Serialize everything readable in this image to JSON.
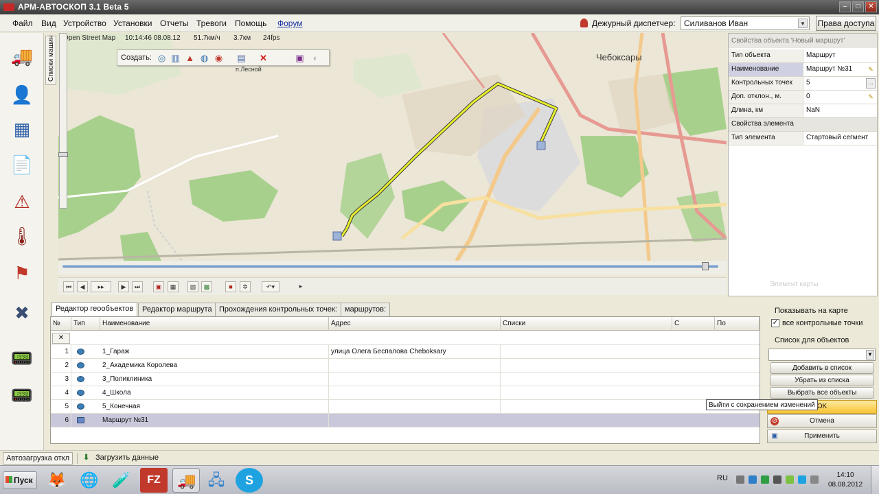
{
  "window": {
    "title": "АРМ-АВТОСКОП 3.1 Beta 5",
    "controls": {
      "minimize": "–",
      "maximize": "□",
      "close": "✕"
    }
  },
  "menu": {
    "items": [
      "Файл",
      "Вид",
      "Устройство",
      "Установки",
      "Отчеты",
      "Тревоги",
      "Помощь"
    ],
    "link": "Форум",
    "dispatcher_label": "Дежурный диспетчер:",
    "dispatcher_value": "Силиванов Иван",
    "rights_button": "Права доступа"
  },
  "left_toolbar": {
    "vertical_tab": "Списки машин",
    "buttons": [
      {
        "name": "vehicle-card-icon",
        "glyph": "🚚",
        "color": "#5d6e86"
      },
      {
        "name": "driver-icon",
        "glyph": "👤",
        "color": "#2d5d8c"
      },
      {
        "name": "calendar-grid-icon",
        "glyph": "▦",
        "color": "#2f5fa8"
      },
      {
        "name": "document-alert-icon",
        "glyph": "📄",
        "color": "#5f6d7c"
      },
      {
        "name": "alarm-device-icon",
        "glyph": "⚠",
        "color": "#b12a1f"
      },
      {
        "name": "temperature-icon",
        "glyph": "🌡",
        "color": "#8a1f17"
      },
      {
        "name": "route-flags-icon",
        "glyph": "⚑",
        "color": "#c0392b"
      },
      {
        "name": "tools-icon",
        "glyph": "✖",
        "color": "#3b4f73"
      },
      {
        "name": "tracker-device-icon",
        "glyph": "📟",
        "color": "#b12a1f"
      },
      {
        "name": "tracker-device-2-icon",
        "glyph": "📟",
        "color": "#b12a1f"
      }
    ]
  },
  "map": {
    "provider": "Open Street Map",
    "time": "10:14:46 08.08.12",
    "speed": "51.7км/ч",
    "distance": "3.7км",
    "fps": "24fps",
    "city_label": "Чебоксары",
    "village_label": "п.Лесной",
    "create_label": "Создать:",
    "route_color": "#e8ef2a",
    "timeline_position": 0.98
  },
  "properties": {
    "header": "Свойства объекта 'Новый маршрут'",
    "rows": [
      {
        "key": "Тип объекта",
        "value": "Маршрут"
      },
      {
        "key": "Наименование",
        "value": "Маршрут №31"
      },
      {
        "key": "Контрольных точек",
        "value": "5"
      },
      {
        "key": "Доп. отклон., м.",
        "value": "0"
      },
      {
        "key": "Длина, км",
        "value": "NaN"
      },
      {
        "key": "Свойства элемента",
        "value": ""
      },
      {
        "key": "Тип элемента",
        "value": "Стартовый сегмент"
      }
    ],
    "footer": "Элемент карты"
  },
  "editor": {
    "tabs": [
      "Редактор геообъектов",
      "Редактор маршрута",
      "Прохождения контрольных точек:",
      "маршрутов:"
    ],
    "columns": [
      "№",
      "Тип",
      "Наименование",
      "Адрес",
      "Списки",
      "С",
      "По"
    ],
    "filter_clear": "✕",
    "rows": [
      {
        "num": "1",
        "name": "1_Гараж",
        "address": "улица Олега Беспалова Cheboksary"
      },
      {
        "num": "2",
        "name": "2_Академика Королева",
        "address": ""
      },
      {
        "num": "3",
        "name": "3_Поликлиника",
        "address": ""
      },
      {
        "num": "4",
        "name": "4_Школа",
        "address": ""
      },
      {
        "num": "5",
        "name": "5_Конечная",
        "address": ""
      },
      {
        "num": "6",
        "name": "Маршрут №31",
        "address": ""
      }
    ]
  },
  "side_controls": {
    "show_on_map": "Показывать на карте",
    "all_checkpoints": "все контрольные точки",
    "list_label": "Список для объектов",
    "add_to_list": "Добавить в список",
    "remove_from_list": "Убрать из списка",
    "select_all": "Выбрать все объекты",
    "ok": "OK",
    "cancel": "Отмена",
    "apply": "Применить",
    "tooltip": "Выйти с сохранением изменений"
  },
  "statusbar": {
    "autoload": "Автозагрузка откл",
    "load_data": "Загрузить данные"
  },
  "taskbar": {
    "start": "Пуск",
    "language": "RU",
    "time": "14:10",
    "date": "08.08.2012",
    "apps": [
      {
        "name": "firefox-icon",
        "glyph": "🦊"
      },
      {
        "name": "mail-client-icon",
        "glyph": "🌐"
      },
      {
        "name": "media-app-icon",
        "glyph": "🧪"
      },
      {
        "name": "filezilla-icon",
        "glyph": "FZ"
      },
      {
        "name": "autoscop-icon",
        "glyph": "🚚"
      },
      {
        "name": "network-app-icon",
        "glyph": "🖧"
      },
      {
        "name": "skype-icon",
        "glyph": "S"
      }
    ]
  }
}
